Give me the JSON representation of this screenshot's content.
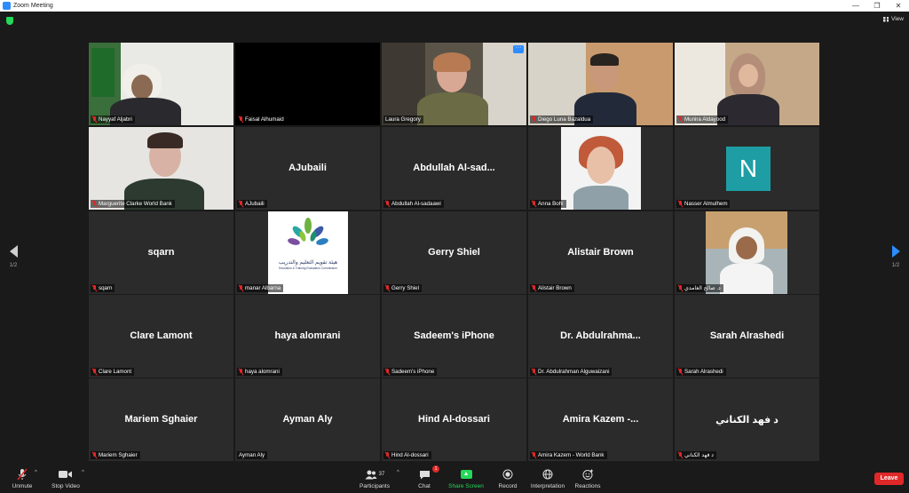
{
  "window": {
    "title": "Zoom Meeting",
    "controls": [
      "—",
      "❐",
      "✕"
    ]
  },
  "header": {
    "view_label": "View"
  },
  "pager": {
    "left": "1/2",
    "right": "1/2"
  },
  "tiles": [
    {
      "label": "Nayyaf Aljabri",
      "display": "",
      "kind": "video"
    },
    {
      "label": "Faisal Alhumaid",
      "display": "",
      "kind": "black"
    },
    {
      "label": "Laura Gregory",
      "display": "",
      "kind": "video",
      "active": true
    },
    {
      "label": "Diego Luna Bazaldua",
      "display": "",
      "kind": "video"
    },
    {
      "label": "Munira Aldayood",
      "display": "",
      "kind": "video"
    },
    {
      "label": "Marguerite Clarke World Bank",
      "display": "",
      "kind": "video"
    },
    {
      "label": "AJubaili",
      "display": "AJubaili",
      "kind": "name"
    },
    {
      "label": "Abdullah Al-sadaawi",
      "display": "Abdullah  Al-sad...",
      "kind": "name"
    },
    {
      "label": "Anna Bohi",
      "display": "",
      "kind": "photo"
    },
    {
      "label": "Nasser Almulhem",
      "display": "N",
      "kind": "avatar"
    },
    {
      "label": "sqarn",
      "display": "sqarn",
      "kind": "name"
    },
    {
      "label": "manar Albarna",
      "display": "",
      "kind": "logo"
    },
    {
      "label": "Gerry Shiel",
      "display": "Gerry Shiel",
      "kind": "name"
    },
    {
      "label": "Alistair Brown",
      "display": "Alistair Brown",
      "kind": "name"
    },
    {
      "label": "د. صالح الغامدي",
      "display": "",
      "kind": "photo"
    },
    {
      "label": "Clare Lamont",
      "display": "Clare Lamont",
      "kind": "name"
    },
    {
      "label": "haya alomrani",
      "display": "haya alomrani",
      "kind": "name"
    },
    {
      "label": "Sadeem's iPhone",
      "display": "Sadeem's iPhone",
      "kind": "name"
    },
    {
      "label": "Dr. Abdulrahman Alguwaizani",
      "display": "Dr.  Abdulrahma...",
      "kind": "name"
    },
    {
      "label": "Sarah Alrashedi",
      "display": "Sarah Alrashedi",
      "kind": "name"
    },
    {
      "label": "Mariem Sghaier",
      "display": "Mariem Sghaier",
      "kind": "name"
    },
    {
      "label": "Ayman Aly",
      "display": "Ayman Aly",
      "kind": "name"
    },
    {
      "label": "Hind Al-dossari",
      "display": "Hind Al-dossari",
      "kind": "name"
    },
    {
      "label": "Amira Kazem - World Bank",
      "display": "Amira Kazem  -...",
      "kind": "name"
    },
    {
      "label": "د فهد الكناني",
      "display": "د فهد الكناني",
      "kind": "name"
    }
  ],
  "logo": {
    "org_text_ar": "هيئة تقويم التعليم والتدريب",
    "org_text_en": "Education & Training Evaluation Commission"
  },
  "toolbar": {
    "unmute": "Unmute",
    "stop_video": "Stop Video",
    "participants": "Participants",
    "participants_count": "37",
    "chat": "Chat",
    "chat_badge": "1",
    "share_screen": "Share Screen",
    "record": "Record",
    "interpretation": "Interpretation",
    "reactions": "Reactions",
    "leave": "Leave"
  },
  "colors": {
    "accent": "#2d8cff",
    "active_border": "#e5e553",
    "share_green": "#23d959",
    "leave_red": "#e02828",
    "avatar_teal": "#1e9ea4"
  }
}
